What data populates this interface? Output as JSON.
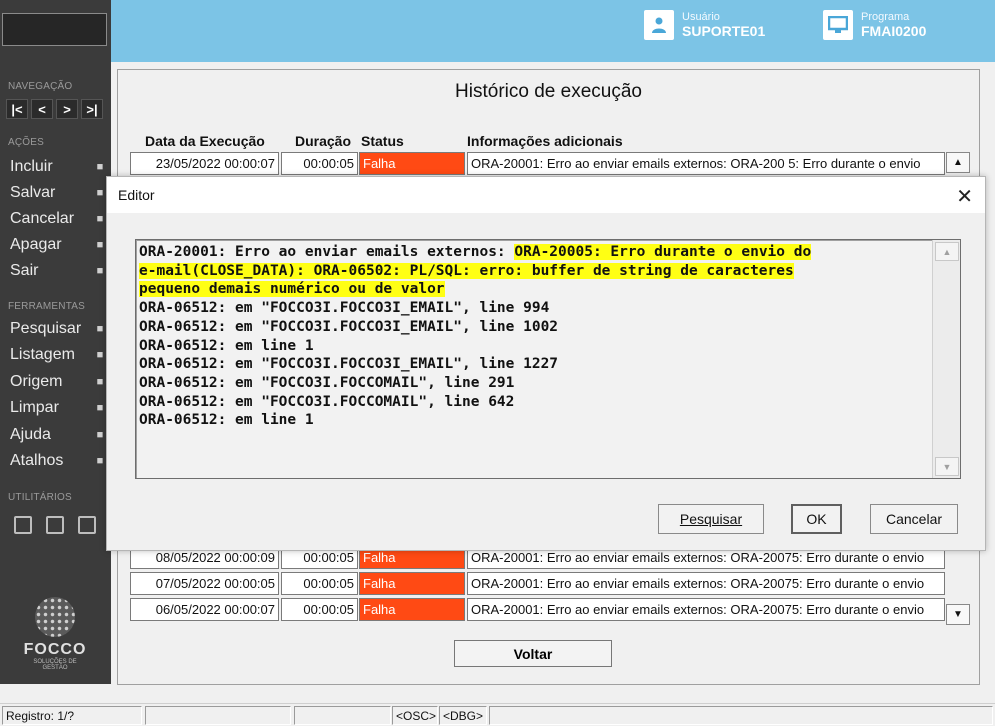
{
  "header": {
    "user_caption": "Usuário",
    "user_value": "SUPORTE01",
    "program_caption": "Programa",
    "program_value": "FMAI0200",
    "bg_color": "#7cc4e6"
  },
  "sidebar": {
    "nav_section": "NAVEGAÇÃO",
    "nav_buttons": [
      "K",
      "<",
      ">",
      ">I"
    ],
    "actions_section": "AÇÕES",
    "actions": [
      {
        "label": "Incluir",
        "icon": "plus-icon"
      },
      {
        "label": "Salvar",
        "icon": "save-icon"
      },
      {
        "label": "Cancelar",
        "icon": "x-icon"
      },
      {
        "label": "Apagar",
        "icon": "trash-icon"
      },
      {
        "label": "Sair",
        "icon": "exit-icon"
      }
    ],
    "tools_section": "FERRAMENTAS",
    "tools": [
      {
        "label": "Pesquisar",
        "icon": "search-icon"
      },
      {
        "label": "Listagem",
        "icon": "list-icon"
      },
      {
        "label": "Origem",
        "icon": "undo-icon"
      },
      {
        "label": "Limpar",
        "icon": "eraser-icon"
      },
      {
        "label": "Ajuda",
        "icon": "help-icon"
      },
      {
        "label": "Atalhos",
        "icon": "shortcut-icon"
      }
    ],
    "utilities_section": "UTILITÁRIOS",
    "logo_text": "FOCCO",
    "logo_tagline": "SOLUÇÕES DE GESTÃO"
  },
  "main": {
    "title": "Histórico de execução",
    "columns": {
      "date": "Data da Execução",
      "duration": "Duração",
      "status": "Status",
      "info": "Informações adicionais"
    },
    "rows_top": [
      {
        "date": "23/05/2022 00:00:07",
        "duration": "00:00:05",
        "status": "Falha",
        "info": "ORA-20001: Erro ao enviar emails externos: ORA-200 5: Erro durante o envio"
      }
    ],
    "rows_bottom": [
      {
        "date": "08/05/2022 00:00:09",
        "duration": "00:00:05",
        "status": "Falha",
        "info": "ORA-20001: Erro ao enviar emails externos: ORA-20075: Erro durante o envio"
      },
      {
        "date": "07/05/2022 00:00:05",
        "duration": "00:00:05",
        "status": "Falha",
        "info": "ORA-20001: Erro ao enviar emails externos: ORA-20075: Erro durante o envio"
      },
      {
        "date": "06/05/2022 00:00:07",
        "duration": "00:00:05",
        "status": "Falha",
        "info": "ORA-20001: Erro ao enviar emails externos: ORA-20075: Erro durante o envio"
      }
    ],
    "status_color": "#ff4a14",
    "back_button": "Voltar"
  },
  "dialog": {
    "title": "Editor",
    "lines": [
      {
        "plain": "ORA-20001: Erro ao enviar emails externos: ",
        "highlight": "ORA-20005: Erro durante o envio do"
      },
      {
        "plain": "",
        "highlight": "e-mail(CLOSE_DATA): ORA-06502: PL/SQL: erro: buffer de string de caracteres"
      },
      {
        "plain": "",
        "highlight": "pequeno demais numérico ou de valor"
      },
      {
        "plain": "ORA-06512: em \"FOCCO3I.FOCCO3I_EMAIL\", line 994",
        "highlight": ""
      },
      {
        "plain": "ORA-06512: em \"FOCCO3I.FOCCO3I_EMAIL\", line 1002",
        "highlight": ""
      },
      {
        "plain": "ORA-06512: em line 1",
        "highlight": ""
      },
      {
        "plain": "ORA-06512: em \"FOCCO3I.FOCCO3I_EMAIL\", line 1227",
        "highlight": ""
      },
      {
        "plain": "ORA-06512: em \"FOCCO3I.FOCCOMAIL\", line 291",
        "highlight": ""
      },
      {
        "plain": "ORA-06512: em \"FOCCO3I.FOCCOMAIL\", line 642",
        "highlight": ""
      },
      {
        "plain": "ORA-06512: em line 1",
        "highlight": ""
      }
    ],
    "highlight_color": "#ffff14",
    "search_button": "Pesquisar",
    "ok_button": "OK",
    "cancel_button": "Cancelar"
  },
  "statusbar": {
    "record": "Registro: 1/?",
    "osc": "<OSC>",
    "dbg": "<DBG>"
  }
}
